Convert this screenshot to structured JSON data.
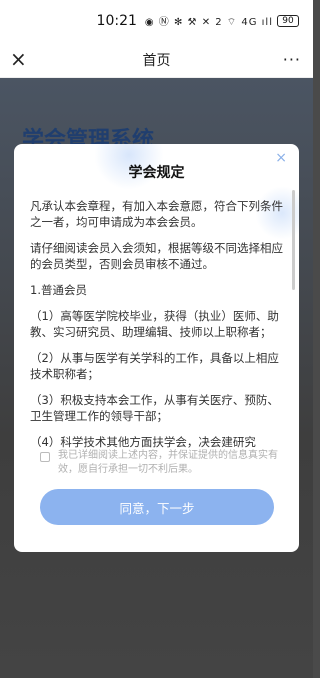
{
  "status_bar": {
    "time": "10:21",
    "icons_text": "◉ Ⓝ ✻ ⚒ ✕ 2 ⌔ 4G ıll",
    "battery": "90"
  },
  "nav": {
    "title": "首页",
    "close_icon": "×",
    "more_icon": "···"
  },
  "background": {
    "title": "学会管理系统"
  },
  "modal": {
    "title": "学会规定",
    "close_icon": "×",
    "paragraphs": [
      "凡承认本会章程，有加入本会意愿，符合下列条件之一者，均可申请成为本会会员。",
      "请仔细阅读会员入会须知，根据等级不同选择相应的会员类型，否则会员审核不通过。",
      "1.普通会员",
      "（1）高等医学院校毕业，获得（执业）医师、助教、实习研究员、助理编辑、技师以上职称者；",
      "（2）从事与医学有关学科的工作，具备以上相应技术职称者；",
      "（3）积极支持本会工作，从事有关医疗、预防、卫生管理工作的领导干部；",
      "（4）科学技术其他方面扶学会，决会建研究"
    ],
    "agree_text": "我已详细阅读上述内容，并保证提供的信息真实有效，愿自行承担一切不利后果。",
    "next_button": "同意，下一步"
  }
}
